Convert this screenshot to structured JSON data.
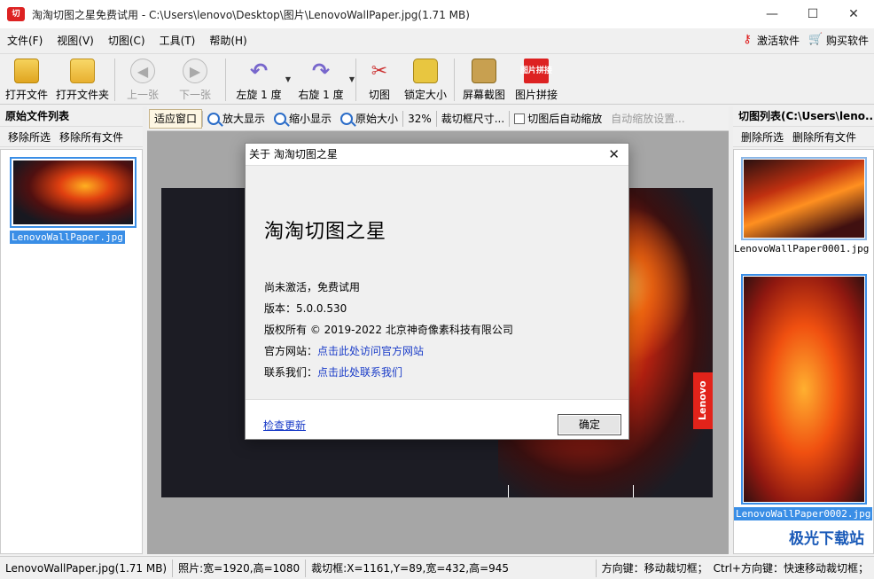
{
  "app": {
    "window_title": "淘淘切图之星免费试用 - C:\\Users\\lenovo\\Desktop\\图片\\LenovoWallPaper.jpg(1.71 MB)",
    "icon_text": "切"
  },
  "window_controls": {
    "minimize": "—",
    "maximize": "☐",
    "close": "✕"
  },
  "menu": {
    "items": [
      "文件(F)",
      "视图(V)",
      "切图(C)",
      "工具(T)",
      "帮助(H)"
    ],
    "activate": "激活软件",
    "buy": "购买软件"
  },
  "toolbar": {
    "open_file": "打开文件",
    "open_folder": "打开文件夹",
    "prev": "上一张",
    "next": "下一张",
    "rotate_left": "左旋 1 度",
    "rotate_right": "右旋 1 度",
    "cut": "切图",
    "lock_size": "锁定大小",
    "screenshot": "屏幕截图",
    "stitch": "图片拼接",
    "stitch_icon_text": "图片拼接"
  },
  "left_panel": {
    "title": "原始文件列表",
    "remove_selected": "移除所选",
    "remove_all": "移除所有文件",
    "files": [
      {
        "name": "LenovoWallPaper.jpg"
      }
    ]
  },
  "view_toolbar": {
    "fit_window": "适应窗口",
    "zoom_in": "放大显示",
    "zoom_out": "缩小显示",
    "original": "原始大小",
    "zoom_level": "32%",
    "crop_size": "裁切框尺寸...",
    "auto_zoom_label": "切图后自动缩放",
    "auto_zoom_settings": "自动缩放设置..."
  },
  "preview": {
    "brand_tag": "Lenovo"
  },
  "right_panel": {
    "title": "切图列表(C:\\Users\\leno...",
    "delete_selected": "删除所选",
    "delete_all": "删除所有文件",
    "files": [
      {
        "name": "LenovoWallPaper0001.jpg"
      },
      {
        "name": "LenovoWallPaper0002.jpg"
      }
    ],
    "watermark": "极光下载站"
  },
  "status": {
    "file": "LenovoWallPaper.jpg(1.71 MB)",
    "photo": "照片:宽=1920,高=1080",
    "crop": "裁切框:X=1161,Y=89,宽=432,高=945",
    "hint1": "方向键：移动裁切框；",
    "hint2": "Ctrl+方向键：快速移动裁切框；"
  },
  "about": {
    "title": "关于 淘淘切图之星",
    "app_name": "淘淘切图之星",
    "status": "尚未激活，免费试用",
    "version_label": "版本：",
    "version": "5.0.0.530",
    "copyright": "版权所有 © 2019-2022 北京神奇像素科技有限公司",
    "website_label": "官方网站：",
    "website_link": "点击此处访问官方网站",
    "contact_label": "联系我们：",
    "contact_link": "点击此处联系我们",
    "check_update": "检查更新",
    "ok": "确定"
  }
}
